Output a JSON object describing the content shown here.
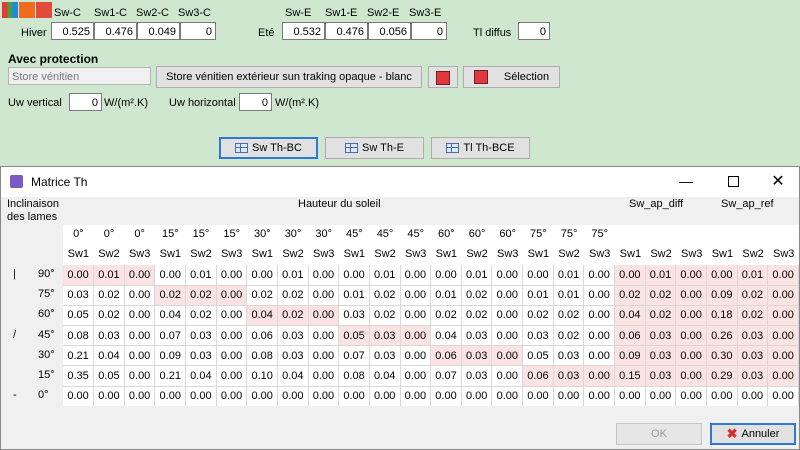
{
  "top": {
    "col_headers_c": [
      "Sw-C",
      "Sw1-C",
      "Sw2-C",
      "Sw3-C"
    ],
    "col_headers_e": [
      "Sw-E",
      "Sw1-E",
      "Sw2-E",
      "Sw3-E"
    ],
    "hiver_label": "Hiver",
    "ete_label": "Eté",
    "hiver_values": [
      "0.525",
      "0.476",
      "0.049",
      "0"
    ],
    "ete_values": [
      "0.532",
      "0.476",
      "0.056",
      "0"
    ],
    "tl_diffus_label": "Tl diffus",
    "tl_diffus_value": "0"
  },
  "protection": {
    "title": "Avec protection",
    "store_placeholder": "Store vénitien",
    "store_button": "Store vénitien extérieur sun traking opaque - blanc",
    "selection_button": "Sélection",
    "uw_vertical_label": "Uw vertical",
    "uw_vertical_value": "0",
    "uw_vertical_unit": "W/(m².K)",
    "uw_horizontal_label": "Uw horizontal",
    "uw_horizontal_value": "0",
    "uw_horizontal_unit": "W/(m².K)"
  },
  "tabs": [
    "Sw Th-BC",
    "Sw Th-E",
    "Tl Th-BCE"
  ],
  "dialog": {
    "title": "Matrice Th",
    "inclinaison_label": "Inclinaison des lames",
    "hauteur_label": "Hauteur du soleil",
    "sw_ap_diff_label": "Sw_ap_diff",
    "sw_ap_ref_label": "Sw_ap_ref",
    "angle_headers": [
      "0°",
      "0°",
      "0°",
      "15°",
      "15°",
      "15°",
      "30°",
      "30°",
      "30°",
      "45°",
      "45°",
      "45°",
      "60°",
      "60°",
      "60°",
      "75°",
      "75°",
      "75°"
    ],
    "sub_headers": [
      "Sw1",
      "Sw2",
      "Sw3",
      "Sw1",
      "Sw2",
      "Sw3",
      "Sw1",
      "Sw2",
      "Sw3",
      "Sw1",
      "Sw2",
      "Sw3",
      "Sw1",
      "Sw2",
      "Sw3",
      "Sw1",
      "Sw2",
      "Sw3",
      "Sw1",
      "Sw2",
      "Sw3",
      "Sw1",
      "Sw2",
      "Sw3"
    ],
    "row_labels": [
      "90°",
      "75°",
      "60°",
      "45°",
      "30°",
      "15°",
      "0°"
    ],
    "row_symbols": [
      "|",
      "",
      "",
      "/",
      "",
      "",
      "-"
    ],
    "rows": [
      [
        "0.00",
        "0.01",
        "0.00",
        "0.00",
        "0.01",
        "0.00",
        "0.00",
        "0.01",
        "0.00",
        "0.00",
        "0.01",
        "0.00",
        "0.00",
        "0.01",
        "0.00",
        "0.00",
        "0.01",
        "0.00",
        "0.00",
        "0.01",
        "0.00",
        "0.00",
        "0.01",
        "0.00"
      ],
      [
        "0.03",
        "0.02",
        "0.00",
        "0.02",
        "0.02",
        "0.00",
        "0.02",
        "0.02",
        "0.00",
        "0.01",
        "0.02",
        "0.00",
        "0.01",
        "0.02",
        "0.00",
        "0.01",
        "0.01",
        "0.00",
        "0.02",
        "0.02",
        "0.00",
        "0.09",
        "0.02",
        "0.00"
      ],
      [
        "0.05",
        "0.02",
        "0.00",
        "0.04",
        "0.02",
        "0.00",
        "0.04",
        "0.02",
        "0.00",
        "0.03",
        "0.02",
        "0.00",
        "0.02",
        "0.02",
        "0.00",
        "0.02",
        "0.02",
        "0.00",
        "0.04",
        "0.02",
        "0.00",
        "0.18",
        "0.02",
        "0.00"
      ],
      [
        "0.08",
        "0.03",
        "0.00",
        "0.07",
        "0.03",
        "0.00",
        "0.06",
        "0.03",
        "0.00",
        "0.05",
        "0.03",
        "0.00",
        "0.04",
        "0.03",
        "0.00",
        "0.03",
        "0.02",
        "0.00",
        "0.06",
        "0.03",
        "0.00",
        "0.26",
        "0.03",
        "0.00"
      ],
      [
        "0.21",
        "0.04",
        "0.00",
        "0.09",
        "0.03",
        "0.00",
        "0.08",
        "0.03",
        "0.00",
        "0.07",
        "0.03",
        "0.00",
        "0.06",
        "0.03",
        "0.00",
        "0.05",
        "0.03",
        "0.00",
        "0.09",
        "0.03",
        "0.00",
        "0.30",
        "0.03",
        "0.00"
      ],
      [
        "0.35",
        "0.05",
        "0.00",
        "0.21",
        "0.04",
        "0.00",
        "0.10",
        "0.04",
        "0.00",
        "0.08",
        "0.04",
        "0.00",
        "0.07",
        "0.03",
        "0.00",
        "0.06",
        "0.03",
        "0.00",
        "0.15",
        "0.03",
        "0.00",
        "0.29",
        "0.03",
        "0.00"
      ],
      [
        "0.00",
        "0.00",
        "0.00",
        "0.00",
        "0.00",
        "0.00",
        "0.00",
        "0.00",
        "0.00",
        "0.00",
        "0.00",
        "0.00",
        "0.00",
        "0.00",
        "0.00",
        "0.00",
        "0.00",
        "0.00",
        "0.00",
        "0.00",
        "0.00",
        "0.00",
        "0.00",
        "0.00"
      ]
    ],
    "ok_button": "OK",
    "cancel_button": "Annuler"
  }
}
